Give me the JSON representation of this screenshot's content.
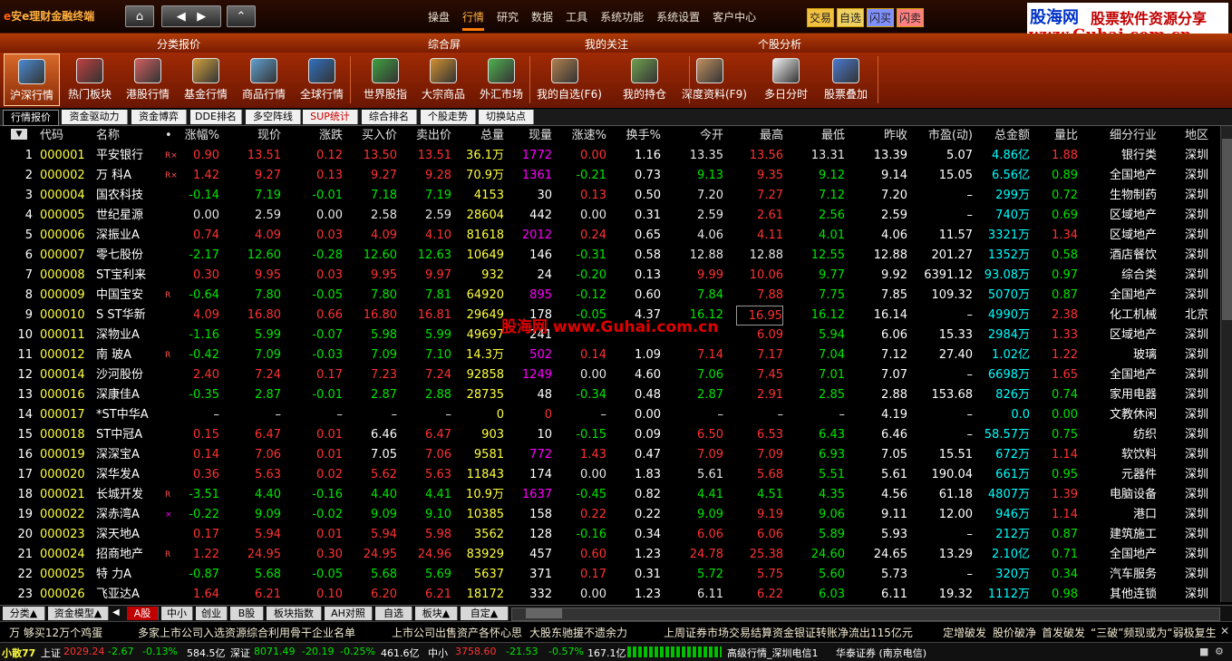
{
  "title": {
    "logo_e": "e",
    "logo_text": "安e理财金融终端"
  },
  "menu": [
    "操盘",
    "行情",
    "研究",
    "数据",
    "工具",
    "系统功能",
    "系统设置",
    "客户中心"
  ],
  "menu_active_index": 1,
  "quick": [
    {
      "label": "交易",
      "bg": "#f0c040"
    },
    {
      "label": "自选",
      "bg": "#f0d060"
    },
    {
      "label": "闪买",
      "bg": "#8090ff"
    },
    {
      "label": "闪卖",
      "bg": "#ff8080"
    }
  ],
  "brand": {
    "line1": "股海网",
    "line2": "股票软件资源分享",
    "line3": "www.Guhai.com.cn"
  },
  "categories": [
    "分类报价",
    "综合屏",
    "我的关注",
    "个股分析"
  ],
  "toolbar": [
    {
      "label": "沪深行情",
      "icon": "chart-window-icon",
      "color": "#4a8ad0"
    },
    {
      "label": "热门板块",
      "icon": "hot-sector-icon",
      "color": "#c04040"
    },
    {
      "label": "港股行情",
      "icon": "hk-stock-icon",
      "color": "#d06060"
    },
    {
      "label": "基金行情",
      "icon": "fund-icon",
      "color": "#d0a040"
    },
    {
      "label": "商品行情",
      "icon": "commodity-icon",
      "color": "#60a0d0"
    },
    {
      "label": "全球行情",
      "icon": "globe-icon",
      "color": "#3070c0"
    },
    {
      "label": "世界股指",
      "icon": "world-index-icon",
      "color": "#40a040"
    },
    {
      "label": "大宗商品",
      "icon": "box-icon",
      "color": "#d09030"
    },
    {
      "label": "外汇市场",
      "icon": "forex-icon",
      "color": "#50b050"
    },
    {
      "label": "我的自选(F6)",
      "icon": "user-icon",
      "color": "#b08050"
    },
    {
      "label": "我的持仓",
      "icon": "gauge-icon",
      "color": "#70a050"
    },
    {
      "label": "深度资料(F9)",
      "icon": "document-box-icon",
      "color": "#c09060"
    },
    {
      "label": "多日分时",
      "icon": "calendar-icon",
      "color": "#f0f0f0"
    },
    {
      "label": "股票叠加",
      "icon": "stack-window-icon",
      "color": "#4a7ad0"
    }
  ],
  "tabs": [
    "行情报价",
    "资金驱动力",
    "资金博弈",
    "DDE排名",
    "多空阵线",
    "SUP统计",
    "综合排名",
    "个股走势",
    "切换站点"
  ],
  "tab_current": 0,
  "tab_hot": 5,
  "columns": [
    "代码",
    "名称",
    "•",
    "涨幅%",
    "现价",
    "涨跌",
    "买入价",
    "卖出价",
    "总量",
    "现量",
    "涨速%",
    "换手%",
    "今开",
    "最高",
    "最低",
    "昨收",
    "市盈(动)",
    "总金额",
    "量比",
    "细分行业",
    "地区"
  ],
  "col_sort_icon": "sort-down-icon",
  "rows": [
    {
      "n": "1",
      "code": "000001",
      "name": "平安银行",
      "flag": "R×",
      "chg": "0.90",
      "price": "13.51",
      "up": "0.12",
      "bid": "13.50",
      "ask": "13.51",
      "vol": "36.1万",
      "cur": "1772",
      "spd": "0.00",
      "turn": "1.16",
      "open": "13.35",
      "high": "13.56",
      "low": "13.31",
      "prev": "13.39",
      "pe": "5.07",
      "amt": "4.86亿",
      "ratio": "1.88",
      "ind": "银行类",
      "area": "深圳",
      "dir": "u",
      "cd": "m",
      "od": "n",
      "hd": "u",
      "ld": "n",
      "sd": "u",
      "ad": "u",
      "rd": "u"
    },
    {
      "n": "2",
      "code": "000002",
      "name": "万  科A",
      "flag": "R×",
      "chg": "1.42",
      "price": "9.27",
      "up": "0.13",
      "bid": "9.27",
      "ask": "9.28",
      "vol": "70.9万",
      "cur": "1361",
      "spd": "-0.21",
      "turn": "0.73",
      "open": "9.13",
      "high": "9.35",
      "low": "9.12",
      "prev": "9.14",
      "pe": "15.05",
      "amt": "6.56亿",
      "ratio": "0.89",
      "ind": "全国地产",
      "area": "深圳",
      "dir": "u",
      "cd": "m",
      "od": "d",
      "hd": "u",
      "ld": "d",
      "sd": "d",
      "ad": "u",
      "rd": "d"
    },
    {
      "n": "3",
      "code": "000004",
      "name": "国农科技",
      "flag": "",
      "chg": "-0.14",
      "price": "7.19",
      "up": "-0.01",
      "bid": "7.18",
      "ask": "7.19",
      "vol": "4153",
      "cur": "30",
      "spd": "0.13",
      "turn": "0.50",
      "open": "7.20",
      "high": "7.27",
      "low": "7.12",
      "prev": "7.20",
      "pe": "–",
      "amt": "299万",
      "ratio": "0.72",
      "ind": "生物制药",
      "area": "深圳",
      "dir": "d",
      "cd": "w",
      "od": "n",
      "hd": "u",
      "ld": "d",
      "sd": "u",
      "ad": "d",
      "rd": "d"
    },
    {
      "n": "4",
      "code": "000005",
      "name": "世纪星源",
      "flag": "",
      "chg": "0.00",
      "price": "2.59",
      "up": "0.00",
      "bid": "2.58",
      "ask": "2.59",
      "vol": "28604",
      "cur": "442",
      "spd": "0.00",
      "turn": "0.31",
      "open": "2.59",
      "high": "2.61",
      "low": "2.56",
      "prev": "2.59",
      "pe": "–",
      "amt": "740万",
      "ratio": "0.69",
      "ind": "区域地产",
      "area": "深圳",
      "dir": "n",
      "cd": "w",
      "od": "n",
      "hd": "u",
      "ld": "d",
      "sd": "n",
      "ad": "d",
      "rd": "d"
    },
    {
      "n": "5",
      "code": "000006",
      "name": "深振业A",
      "flag": "",
      "chg": "0.74",
      "price": "4.09",
      "up": "0.03",
      "bid": "4.09",
      "ask": "4.10",
      "vol": "81618",
      "cur": "2012",
      "spd": "0.24",
      "turn": "0.65",
      "open": "4.06",
      "high": "4.11",
      "low": "4.01",
      "prev": "4.06",
      "pe": "11.57",
      "amt": "3321万",
      "ratio": "1.34",
      "ind": "区域地产",
      "area": "深圳",
      "dir": "u",
      "cd": "m",
      "od": "n",
      "hd": "u",
      "ld": "d",
      "sd": "u",
      "ad": "d",
      "rd": "u"
    },
    {
      "n": "6",
      "code": "000007",
      "name": "零七股份",
      "flag": "",
      "chg": "-2.17",
      "price": "12.60",
      "up": "-0.28",
      "bid": "12.60",
      "ask": "12.63",
      "vol": "10649",
      "cur": "146",
      "spd": "-0.31",
      "turn": "0.58",
      "open": "12.88",
      "high": "12.88",
      "low": "12.55",
      "prev": "12.88",
      "pe": "201.27",
      "amt": "1352万",
      "ratio": "0.58",
      "ind": "酒店餐饮",
      "area": "深圳",
      "dir": "d",
      "cd": "w",
      "od": "n",
      "hd": "n",
      "ld": "d",
      "sd": "d",
      "ad": "d",
      "rd": "d"
    },
    {
      "n": "7",
      "code": "000008",
      "name": "ST宝利来",
      "flag": "",
      "chg": "0.30",
      "price": "9.95",
      "up": "0.03",
      "bid": "9.95",
      "ask": "9.97",
      "vol": "932",
      "cur": "24",
      "spd": "-0.20",
      "turn": "0.13",
      "open": "9.99",
      "high": "10.06",
      "low": "9.77",
      "prev": "9.92",
      "pe": "6391.12",
      "amt": "93.08万",
      "ratio": "0.97",
      "ind": "综合类",
      "area": "深圳",
      "dir": "u",
      "cd": "w",
      "od": "u",
      "hd": "u",
      "ld": "d",
      "sd": "d",
      "ad": "d",
      "rd": "d"
    },
    {
      "n": "8",
      "code": "000009",
      "name": "中国宝安",
      "flag": "R",
      "chg": "-0.64",
      "price": "7.80",
      "up": "-0.05",
      "bid": "7.80",
      "ask": "7.81",
      "vol": "64920",
      "cur": "895",
      "spd": "-0.12",
      "turn": "0.60",
      "open": "7.84",
      "high": "7.88",
      "low": "7.75",
      "prev": "7.85",
      "pe": "109.32",
      "amt": "5070万",
      "ratio": "0.87",
      "ind": "全国地产",
      "area": "深圳",
      "dir": "d",
      "cd": "m",
      "od": "d",
      "hd": "u",
      "ld": "d",
      "sd": "d",
      "ad": "d",
      "rd": "d"
    },
    {
      "n": "9",
      "code": "000010",
      "name": "S ST华新",
      "flag": "",
      "chg": "4.09",
      "price": "16.80",
      "up": "0.66",
      "bid": "16.80",
      "ask": "16.81",
      "vol": "29649",
      "cur": "178",
      "spd": "-0.05",
      "turn": "4.37",
      "open": "16.12",
      "high": "16.95",
      "low": "16.12",
      "prev": "16.14",
      "pe": "–",
      "amt": "4990万",
      "ratio": "2.38",
      "ind": "化工机械",
      "area": "北京",
      "dir": "u",
      "cd": "w",
      "od": "d",
      "hd": "u",
      "ld": "d",
      "sd": "d",
      "ad": "d",
      "rd": "u"
    },
    {
      "n": "10",
      "code": "000011",
      "name": "深物业A",
      "flag": "",
      "chg": "-1.16",
      "price": "5.99",
      "up": "-0.07",
      "bid": "5.98",
      "ask": "5.99",
      "vol": "49697",
      "cur": "241",
      "spd": "",
      "turn": "",
      "open": "",
      "high": "6.09",
      "low": "5.94",
      "prev": "6.06",
      "pe": "15.33",
      "amt": "2984万",
      "ratio": "1.33",
      "ind": "区域地产",
      "area": "深圳",
      "dir": "d",
      "cd": "w",
      "od": "n",
      "hd": "u",
      "ld": "d",
      "sd": "n",
      "ad": "d",
      "rd": "u"
    },
    {
      "n": "11",
      "code": "000012",
      "name": "南  玻A",
      "flag": "R",
      "chg": "-0.42",
      "price": "7.09",
      "up": "-0.03",
      "bid": "7.09",
      "ask": "7.10",
      "vol": "14.3万",
      "cur": "502",
      "spd": "0.14",
      "turn": "1.09",
      "open": "7.14",
      "high": "7.17",
      "low": "7.04",
      "prev": "7.12",
      "pe": "27.40",
      "amt": "1.02亿",
      "ratio": "1.22",
      "ind": "玻璃",
      "area": "深圳",
      "dir": "d",
      "cd": "m",
      "od": "u",
      "hd": "u",
      "ld": "d",
      "sd": "u",
      "ad": "u",
      "rd": "u"
    },
    {
      "n": "12",
      "code": "000014",
      "name": "沙河股份",
      "flag": "",
      "chg": "2.40",
      "price": "7.24",
      "up": "0.17",
      "bid": "7.23",
      "ask": "7.24",
      "vol": "92858",
      "cur": "1249",
      "spd": "0.00",
      "turn": "4.60",
      "open": "7.06",
      "high": "7.45",
      "low": "7.01",
      "prev": "7.07",
      "pe": "–",
      "amt": "6698万",
      "ratio": "1.65",
      "ind": "全国地产",
      "area": "深圳",
      "dir": "u",
      "cd": "m",
      "od": "d",
      "hd": "u",
      "ld": "d",
      "sd": "n",
      "ad": "d",
      "rd": "u"
    },
    {
      "n": "13",
      "code": "000016",
      "name": "深康佳A",
      "flag": "",
      "chg": "-0.35",
      "price": "2.87",
      "up": "-0.01",
      "bid": "2.87",
      "ask": "2.88",
      "vol": "28735",
      "cur": "48",
      "spd": "-0.34",
      "turn": "0.48",
      "open": "2.87",
      "high": "2.91",
      "low": "2.85",
      "prev": "2.88",
      "pe": "153.68",
      "amt": "826万",
      "ratio": "0.74",
      "ind": "家用电器",
      "area": "深圳",
      "dir": "d",
      "cd": "w",
      "od": "d",
      "hd": "u",
      "ld": "d",
      "sd": "d",
      "ad": "d",
      "rd": "d"
    },
    {
      "n": "14",
      "code": "000017",
      "name": "*ST中华A",
      "flag": "",
      "chg": "–",
      "price": "–",
      "up": "–",
      "bid": "–",
      "ask": "–",
      "vol": "0",
      "cur": "0",
      "spd": "–",
      "turn": "0.00",
      "open": "–",
      "high": "–",
      "low": "–",
      "prev": "4.19",
      "pe": "–",
      "amt": "0.0",
      "ratio": "0.00",
      "ind": "文教休闲",
      "area": "深圳",
      "dir": "n",
      "cd": "w",
      "od": "n",
      "hd": "n",
      "ld": "n",
      "sd": "n",
      "ad": "d",
      "rd": "d",
      "zero_cur": true
    },
    {
      "n": "15",
      "code": "000018",
      "name": "ST中冠A",
      "flag": "",
      "chg": "0.15",
      "price": "6.47",
      "up": "0.01",
      "bid": "6.46",
      "ask": "6.47",
      "vol": "903",
      "cur": "10",
      "spd": "-0.15",
      "turn": "0.09",
      "open": "6.50",
      "high": "6.53",
      "low": "6.43",
      "prev": "6.46",
      "pe": "–",
      "amt": "58.57万",
      "ratio": "0.75",
      "ind": "纺织",
      "area": "深圳",
      "dir": "u",
      "cd": "w",
      "od": "u",
      "hd": "u",
      "ld": "d",
      "sd": "d",
      "ad": "d",
      "rd": "d",
      "bid_white": true
    },
    {
      "n": "16",
      "code": "000019",
      "name": "深深宝A",
      "flag": "",
      "chg": "0.14",
      "price": "7.06",
      "up": "0.01",
      "bid": "7.05",
      "ask": "7.06",
      "vol": "9581",
      "cur": "772",
      "spd": "1.43",
      "turn": "0.47",
      "open": "7.09",
      "high": "7.09",
      "low": "6.93",
      "prev": "7.05",
      "pe": "15.51",
      "amt": "672万",
      "ratio": "1.14",
      "ind": "软饮料",
      "area": "深圳",
      "dir": "u",
      "cd": "m",
      "od": "u",
      "hd": "u",
      "ld": "d",
      "sd": "u",
      "ad": "d",
      "rd": "u",
      "bid_white": true
    },
    {
      "n": "17",
      "code": "000020",
      "name": "深华发A",
      "flag": "",
      "chg": "0.36",
      "price": "5.63",
      "up": "0.02",
      "bid": "5.62",
      "ask": "5.63",
      "vol": "11843",
      "cur": "174",
      "spd": "0.00",
      "turn": "1.83",
      "open": "5.61",
      "high": "5.68",
      "low": "5.51",
      "prev": "5.61",
      "pe": "190.04",
      "amt": "661万",
      "ratio": "0.95",
      "ind": "元器件",
      "area": "深圳",
      "dir": "u",
      "cd": "w",
      "od": "n",
      "hd": "u",
      "ld": "d",
      "sd": "n",
      "ad": "d",
      "rd": "d"
    },
    {
      "n": "18",
      "code": "000021",
      "name": "长城开发",
      "flag": "R",
      "chg": "-3.51",
      "price": "4.40",
      "up": "-0.16",
      "bid": "4.40",
      "ask": "4.41",
      "vol": "10.9万",
      "cur": "1637",
      "spd": "-0.45",
      "turn": "0.82",
      "open": "4.41",
      "high": "4.51",
      "low": "4.35",
      "prev": "4.56",
      "pe": "61.18",
      "amt": "4807万",
      "ratio": "1.39",
      "ind": "电脑设备",
      "area": "深圳",
      "dir": "d",
      "cd": "m",
      "od": "d",
      "hd": "d",
      "ld": "d",
      "sd": "d",
      "ad": "d",
      "rd": "u"
    },
    {
      "n": "19",
      "code": "000022",
      "name": "深赤湾A",
      "flag": "×",
      "chg": "-0.22",
      "price": "9.09",
      "up": "-0.02",
      "bid": "9.09",
      "ask": "9.10",
      "vol": "10385",
      "cur": "158",
      "spd": "0.22",
      "turn": "0.22",
      "open": "9.09",
      "high": "9.19",
      "low": "9.06",
      "prev": "9.11",
      "pe": "12.00",
      "amt": "946万",
      "ratio": "1.14",
      "ind": "港口",
      "area": "深圳",
      "dir": "d",
      "cd": "w",
      "od": "d",
      "hd": "u",
      "ld": "d",
      "sd": "u",
      "ad": "d",
      "rd": "u",
      "flag_mag": true
    },
    {
      "n": "20",
      "code": "000023",
      "name": "深天地A",
      "flag": "",
      "chg": "0.17",
      "price": "5.94",
      "up": "0.01",
      "bid": "5.94",
      "ask": "5.98",
      "vol": "3562",
      "cur": "128",
      "spd": "-0.16",
      "turn": "0.34",
      "open": "6.06",
      "high": "6.06",
      "low": "5.89",
      "prev": "5.93",
      "pe": "–",
      "amt": "212万",
      "ratio": "0.87",
      "ind": "建筑施工",
      "area": "深圳",
      "dir": "u",
      "cd": "w",
      "od": "u",
      "hd": "u",
      "ld": "d",
      "sd": "d",
      "ad": "d",
      "rd": "d"
    },
    {
      "n": "21",
      "code": "000024",
      "name": "招商地产",
      "flag": "R",
      "chg": "1.22",
      "price": "24.95",
      "up": "0.30",
      "bid": "24.95",
      "ask": "24.96",
      "vol": "83929",
      "cur": "457",
      "spd": "0.60",
      "turn": "1.23",
      "open": "24.78",
      "high": "25.38",
      "low": "24.60",
      "prev": "24.65",
      "pe": "13.29",
      "amt": "2.10亿",
      "ratio": "0.71",
      "ind": "全国地产",
      "area": "深圳",
      "dir": "u",
      "cd": "w",
      "od": "u",
      "hd": "u",
      "ld": "d",
      "sd": "u",
      "ad": "u",
      "rd": "d"
    },
    {
      "n": "22",
      "code": "000025",
      "name": "特  力A",
      "flag": "",
      "chg": "-0.87",
      "price": "5.68",
      "up": "-0.05",
      "bid": "5.68",
      "ask": "5.69",
      "vol": "5637",
      "cur": "371",
      "spd": "0.17",
      "turn": "0.31",
      "open": "5.72",
      "high": "5.75",
      "low": "5.60",
      "prev": "5.73",
      "pe": "–",
      "amt": "320万",
      "ratio": "0.34",
      "ind": "汽车服务",
      "area": "深圳",
      "dir": "d",
      "cd": "w",
      "od": "d",
      "hd": "u",
      "ld": "d",
      "sd": "u",
      "ad": "d",
      "rd": "d"
    },
    {
      "n": "23",
      "code": "000026",
      "name": "飞亚达A",
      "flag": "",
      "chg": "1.64",
      "price": "6.21",
      "up": "0.10",
      "bid": "6.20",
      "ask": "6.21",
      "vol": "18172",
      "cur": "332",
      "spd": "0.00",
      "turn": "1.23",
      "open": "6.11",
      "high": "6.22",
      "low": "6.03",
      "prev": "6.11",
      "pe": "19.32",
      "amt": "1112万",
      "ratio": "0.98",
      "ind": "其他连锁",
      "area": "深圳",
      "dir": "u",
      "cd": "w",
      "od": "n",
      "hd": "u",
      "ld": "d",
      "sd": "n",
      "ad": "d",
      "rd": "d"
    }
  ],
  "selected_cell": {
    "row": 8,
    "col": "high"
  },
  "watermark": "股海网  www.Guhai.com.cn",
  "sheet_tabs": [
    "分类▲",
    "资金模型▲",
    "A股",
    "中小",
    "创业",
    "B股",
    "板块指数",
    "AH对照",
    "自选",
    "板块▲",
    "自定▲"
  ],
  "sheet_current": 2,
  "news": [
    {
      "t": "万 够买12万个鸡蛋"
    },
    {
      "t": "多家上市公司入选资源综合利用骨干企业名单"
    },
    {
      "t": "上市公司出售资产各怀心思"
    },
    {
      "t": "大股东驰援不遗余力"
    },
    {
      "t": "上周证券市场交易结算资金银证转账净流出115亿元"
    },
    {
      "t": "定增破发"
    },
    {
      "t": "股价破净"
    },
    {
      "t": "首发破发"
    },
    {
      "t": "“三破”频现或为“弱极复生"
    }
  ],
  "status": {
    "s1": "小散77",
    "s2": "上证",
    "s3": "2029.24",
    "s4": "-2.67",
    "s5": "-0.13%",
    "s6": "584.5亿",
    "s7": "深证",
    "s8": "8071.49",
    "s9": "-20.19",
    "s10": "-0.25%",
    "s11": "461.6亿",
    "s12": "中小",
    "s13": "3758.60",
    "s14": "-21.53",
    "s15": "-0.57%",
    "s16": "167.1亿",
    "s17": "高级行情_深圳电信1",
    "s18": "华泰证券 (南京电信)"
  },
  "colors": {
    "up": "#ff3232",
    "down": "#00e600",
    "flat": "#e6e6e6",
    "code": "#ffff40",
    "name": "#ffffff",
    "vol": "#ffff40",
    "mag": "#ff00ff",
    "cyan": "#00ffff",
    "orange": "#ff8000"
  }
}
